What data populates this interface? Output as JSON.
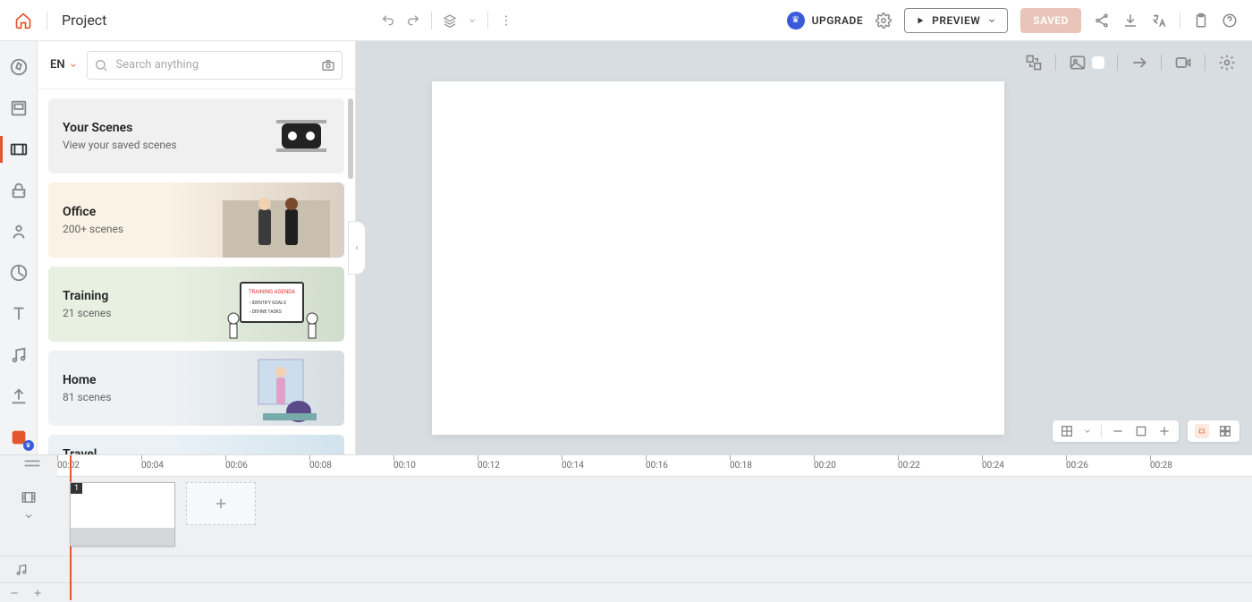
{
  "header": {
    "project_title": "Project",
    "upgrade_label": "UPGRADE",
    "preview_label": "PREVIEW",
    "saved_label": "SAVED"
  },
  "library": {
    "language": "EN",
    "search_placeholder": "Search anything",
    "cards": [
      {
        "title": "Your Scenes",
        "sub": "View your saved scenes"
      },
      {
        "title": "Office",
        "sub": "200+ scenes"
      },
      {
        "title": "Training",
        "sub": "21 scenes"
      },
      {
        "title": "Home",
        "sub": "81 scenes"
      },
      {
        "title": "Travel",
        "sub": ""
      }
    ]
  },
  "timeline": {
    "ticks": [
      "00:02",
      "00:04",
      "00:06",
      "00:08",
      "00:10",
      "00:12",
      "00:14",
      "00:16",
      "00:18",
      "00:20",
      "00:22",
      "00:24",
      "00:26",
      "00:28"
    ],
    "clip_number": "1"
  }
}
